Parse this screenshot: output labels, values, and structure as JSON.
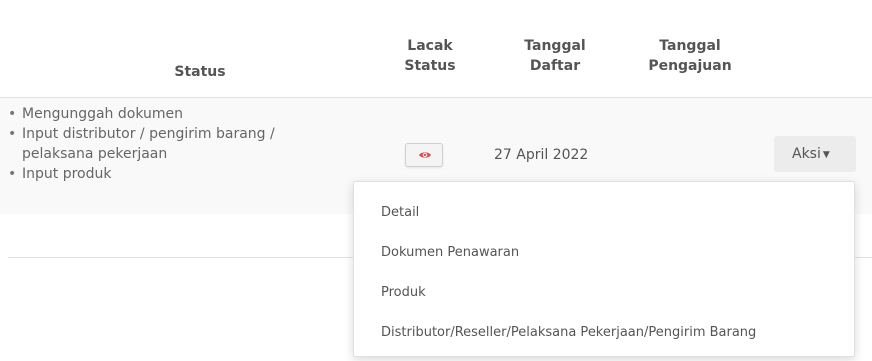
{
  "table": {
    "headers": {
      "status": "Status",
      "lacak_status": [
        "Lacak",
        "Status"
      ],
      "tanggal_daftar": [
        "Tanggal",
        "Daftar"
      ],
      "tanggal_pengajuan": [
        "Tanggal",
        "Pengajuan"
      ]
    },
    "row": {
      "status_items": [
        "Mengunggah dokumen",
        "Input distributor / pengirim barang / pelaksana pekerjaan",
        "Input produk"
      ],
      "tanggal_daftar": "27 April 2022",
      "tanggal_pengajuan": "",
      "track_icon": "eye-icon",
      "action_label": "Aksi"
    }
  },
  "dropdown": {
    "items": [
      "Detail",
      "Dokumen Penawaran",
      "Produk",
      "Distributor/Reseller/Pelaksana Pekerjaan/Pengirim Barang"
    ]
  },
  "colors": {
    "eye_icon": "#d9534f",
    "row_background": "#f9f9f9",
    "button_background": "#ececec"
  }
}
